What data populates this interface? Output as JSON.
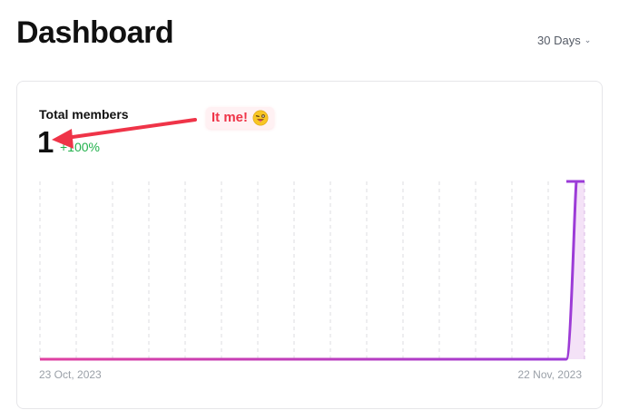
{
  "header": {
    "title": "Dashboard",
    "range_label": "30 Days"
  },
  "card": {
    "metric_label": "Total members",
    "metric_value": "1",
    "metric_change": "+100%",
    "annotation_text": "It me!",
    "annotation_icon": "winking-tongue-face-emoji-icon"
  },
  "colors": {
    "line_start": "#e040a0",
    "line_end": "#9b3bd8",
    "area_fill": "#f4e2f7",
    "change_positive": "#22b14c",
    "annotation": "#ef3448"
  },
  "chart_data": {
    "type": "area",
    "x_tick_labels": [
      "23 Oct, 2023",
      "22 Nov, 2023"
    ],
    "x": [
      "2023-10-23",
      "2023-10-24",
      "2023-10-25",
      "2023-10-26",
      "2023-10-27",
      "2023-10-28",
      "2023-10-29",
      "2023-10-30",
      "2023-10-31",
      "2023-11-01",
      "2023-11-02",
      "2023-11-03",
      "2023-11-04",
      "2023-11-05",
      "2023-11-06",
      "2023-11-07",
      "2023-11-08",
      "2023-11-09",
      "2023-11-10",
      "2023-11-11",
      "2023-11-12",
      "2023-11-13",
      "2023-11-14",
      "2023-11-15",
      "2023-11-16",
      "2023-11-17",
      "2023-11-18",
      "2023-11-19",
      "2023-11-20",
      "2023-11-21",
      "2023-11-22"
    ],
    "series": [
      {
        "values": [
          0,
          0,
          0,
          0,
          0,
          0,
          0,
          0,
          0,
          0,
          0,
          0,
          0,
          0,
          0,
          0,
          0,
          0,
          0,
          0,
          0,
          0,
          0,
          0,
          0,
          0,
          0,
          0,
          0,
          0,
          1
        ]
      }
    ],
    "ylim": [
      0,
      1
    ],
    "grid": "vertical dashed",
    "legend": "none"
  }
}
